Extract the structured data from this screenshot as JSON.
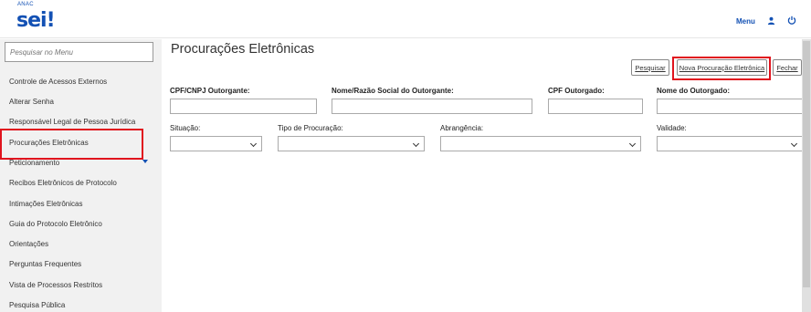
{
  "header": {
    "org": "ANAC",
    "logo": "sei",
    "logo_mark": "!",
    "menu_label": "Menu"
  },
  "sidebar": {
    "search_placeholder": "Pesquisar no Menu",
    "items": [
      {
        "label": "Controle de Acessos Externos"
      },
      {
        "label": "Alterar Senha"
      },
      {
        "label": "Responsável Legal de Pessoa Jurídica"
      },
      {
        "label": "Procurações Eletrônicas"
      },
      {
        "label": "Peticionamento"
      },
      {
        "label": "Recibos Eletrônicos de Protocolo"
      },
      {
        "label": "Intimações Eletrônicas"
      },
      {
        "label": "Guia do Protocolo Eletrônico"
      },
      {
        "label": "Orientações"
      },
      {
        "label": "Perguntas Frequentes"
      },
      {
        "label": "Vista de Processos Restritos"
      },
      {
        "label": "Pesquisa Pública"
      }
    ]
  },
  "main": {
    "title": "Procurações Eletrônicas",
    "buttons": {
      "search": "Pesquisar",
      "new": "Nova Procuração Eletrônica",
      "close": "Fechar"
    },
    "filters": {
      "cpf_cnpj_outorgante": {
        "label": "CPF/CNPJ Outorgante:",
        "value": ""
      },
      "nome_outorgante": {
        "label": "Nome/Razão Social do Outorgante:",
        "value": ""
      },
      "cpf_outorgado": {
        "label": "CPF Outorgado:",
        "value": ""
      },
      "nome_outorgado": {
        "label": "Nome do Outorgado:",
        "value": ""
      },
      "situacao": {
        "label": "Situação:",
        "selected": ""
      },
      "tipo_procuracao": {
        "label": "Tipo de Procuração:",
        "selected": ""
      },
      "abrangencia": {
        "label": "Abrangência:",
        "selected": ""
      },
      "validade": {
        "label": "Validade:",
        "selected": ""
      }
    }
  },
  "colors": {
    "brand": "#1351b4",
    "highlight": "#e0141e",
    "sidebar_bg": "#f1f1f1"
  }
}
